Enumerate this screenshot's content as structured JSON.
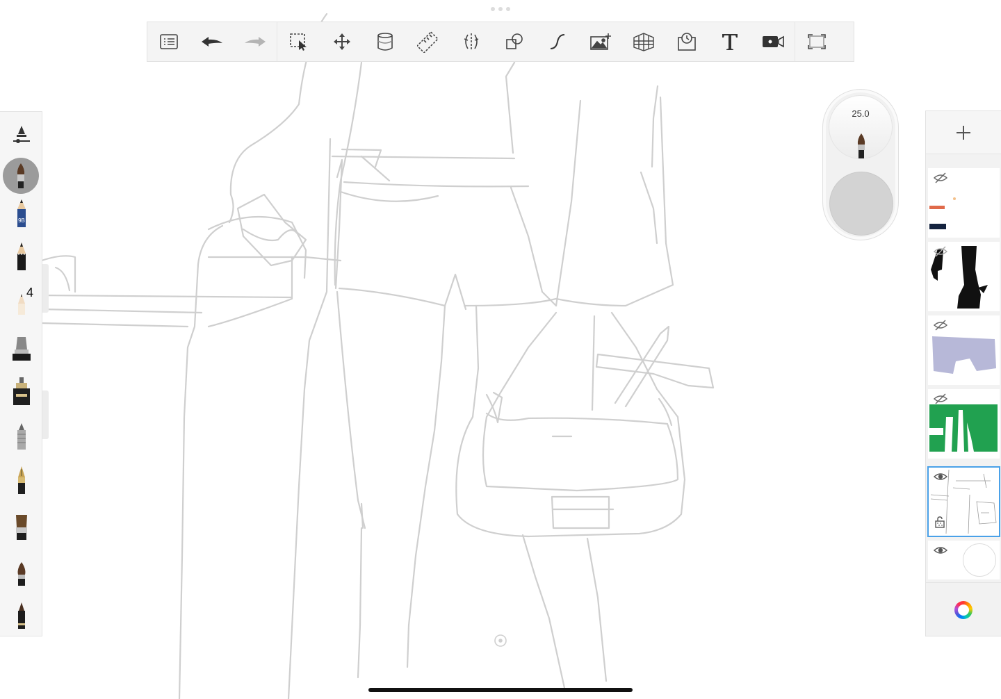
{
  "app": {
    "brush_size_value": "25.0",
    "layer_number_badge": "4",
    "accent_color": "#4aa1e8",
    "sketch_stroke_color": "#cfcfcf"
  },
  "toolbar": {
    "items": [
      {
        "name": "layers-list-icon"
      },
      {
        "name": "undo-icon"
      },
      {
        "name": "redo-icon"
      },
      {
        "name": "selection-icon"
      },
      {
        "name": "transform-icon"
      },
      {
        "name": "fill-bucket-icon"
      },
      {
        "name": "ruler-icon"
      },
      {
        "name": "symmetry-icon"
      },
      {
        "name": "shapes-icon"
      },
      {
        "name": "curve-icon"
      },
      {
        "name": "add-image-icon"
      },
      {
        "name": "perspective-grid-icon"
      },
      {
        "name": "time-lapse-icon"
      },
      {
        "name": "text-icon"
      },
      {
        "name": "record-video-icon"
      },
      {
        "name": "fullscreen-icon"
      }
    ]
  },
  "brushes": [
    {
      "name": "brush-settings-icon"
    },
    {
      "name": "paint-brush-active-icon"
    },
    {
      "name": "pencil-9b-icon",
      "label": "9B"
    },
    {
      "name": "pencil-icon"
    },
    {
      "name": "fine-pencil-icon"
    },
    {
      "name": "marker-icon"
    },
    {
      "name": "ink-pen-icon"
    },
    {
      "name": "airbrush-icon"
    },
    {
      "name": "fountain-pen-icon"
    },
    {
      "name": "flat-brush-icon"
    },
    {
      "name": "round-brush-icon"
    },
    {
      "name": "felt-tip-icon"
    }
  ],
  "layers": [
    {
      "name": "layer-color-swatches",
      "visible": false
    },
    {
      "name": "layer-black-silhouette",
      "visible": false
    },
    {
      "name": "layer-lavender-shorts",
      "visible": false
    },
    {
      "name": "layer-green-fill",
      "visible": false
    },
    {
      "name": "layer-sketch",
      "visible": true,
      "selected": true,
      "locked": true
    },
    {
      "name": "layer-background",
      "visible": true
    }
  ]
}
